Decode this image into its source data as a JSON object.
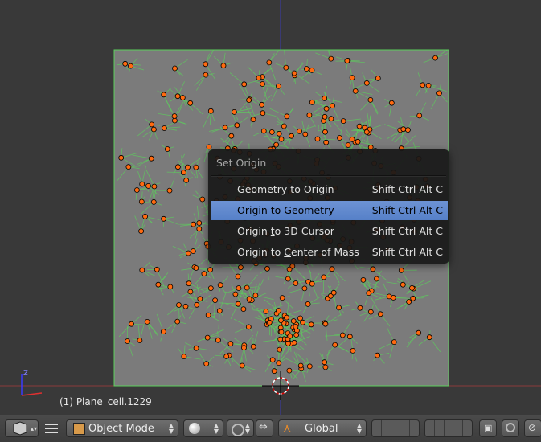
{
  "viewport": {
    "object_info": "(1) Plane_cell.1229",
    "axis_z_label": "z"
  },
  "context_menu": {
    "title": "Set Origin",
    "items": [
      {
        "pre": "",
        "ul": "G",
        "post": "eometry to Origin",
        "shortcut": "Shift Ctrl Alt C",
        "active": false
      },
      {
        "pre": "",
        "ul": "O",
        "post": "rigin to Geometry",
        "shortcut": "Shift Ctrl Alt C",
        "active": true
      },
      {
        "pre": "Origin ",
        "ul": "t",
        "post": "o 3D Cursor",
        "shortcut": "Shift Ctrl Alt C",
        "active": false
      },
      {
        "pre": "Origin to ",
        "ul": "C",
        "post": "enter of Mass",
        "shortcut": "Shift Ctrl Alt C",
        "active": false
      }
    ]
  },
  "toolbar": {
    "mode": "Object Mode",
    "orientation": "Global"
  },
  "colors": {
    "viewport_bg": "#393939",
    "plane_fill": "#7b7b7b",
    "edges": "#5bd05b",
    "vertex": "#ff6a10",
    "menu_highlight": "#5680c8"
  },
  "icons": [
    "view3d-editor-icon",
    "menu-icon",
    "object-mode-cube-icon",
    "viewport-shading-sphere-icon",
    "pivot-point-icon",
    "manipulator-icon",
    "transform-orientation-icon",
    "layers-icon",
    "lock-icon",
    "render-icon",
    "snap-icon"
  ]
}
